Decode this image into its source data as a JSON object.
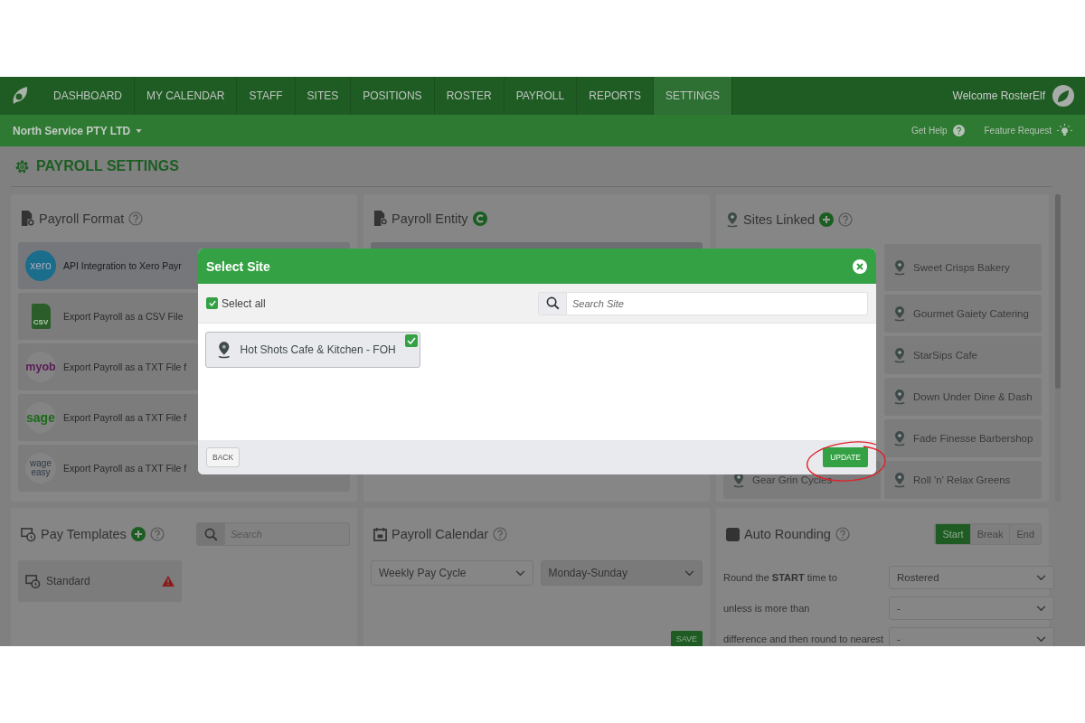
{
  "navbar": {
    "tabs": [
      {
        "label": "DASHBOARD",
        "selected": false
      },
      {
        "label": "MY CALENDAR",
        "selected": false
      },
      {
        "label": "STAFF",
        "selected": false
      },
      {
        "label": "SITES",
        "selected": false
      },
      {
        "label": "POSITIONS",
        "selected": false
      },
      {
        "label": "ROSTER",
        "selected": false
      },
      {
        "label": "PAYROLL",
        "selected": false
      },
      {
        "label": "REPORTS",
        "selected": false
      },
      {
        "label": "SETTINGS",
        "selected": true
      }
    ],
    "welcome": "Welcome RosterElf"
  },
  "subbar": {
    "company": "North Service PTY LTD",
    "links": [
      {
        "label": "Get Help",
        "kind": "help"
      },
      {
        "label": "Feature Request",
        "kind": "idea"
      }
    ]
  },
  "page_title": "PAYROLL SETTINGS",
  "payroll_format": {
    "title": "Payroll Format",
    "options": [
      {
        "kind": "xero",
        "logo": [
          "xero"
        ],
        "label": "API Integration to Xero Payr",
        "selected": true
      },
      {
        "kind": "csv",
        "logo": [
          "CSV"
        ],
        "label": "Export Payroll as a CSV File",
        "selected": false
      },
      {
        "kind": "myob",
        "logo": [
          "myob"
        ],
        "label": "Export Payroll as a TXT File f",
        "selected": false
      },
      {
        "kind": "sage",
        "logo": [
          "sage"
        ],
        "label": "Export Payroll as a TXT File f",
        "selected": false
      },
      {
        "kind": "wageeasy",
        "logo": [
          "wage",
          "easy"
        ],
        "label": "Export Payroll as a TXT File f",
        "selected": false
      }
    ]
  },
  "payroll_entity": {
    "title": "Payroll Entity"
  },
  "sites_linked": {
    "title": "Sites Linked",
    "left_sites": [
      "Gear Grin Cycles"
    ],
    "right_sites": [
      "Sweet Crisps Bakery",
      "Gourmet Gaiety Catering",
      "StarSips Cafe",
      "Down Under Dine & Dash",
      "Fade Finesse Barbershop",
      "Roll 'n' Relax Greens"
    ]
  },
  "pay_templates": {
    "title": "Pay Templates",
    "search_placeholder": "Search",
    "templates": [
      {
        "name": "Standard",
        "warning": true
      }
    ]
  },
  "payroll_calendar": {
    "title": "Payroll Calendar",
    "selects": [
      {
        "value": "Weekly Pay Cycle",
        "disabled": false
      },
      {
        "value": "Monday-Sunday",
        "disabled": true
      }
    ],
    "save": "SAVE"
  },
  "auto_rounding": {
    "title": "Auto Rounding",
    "checked": false,
    "segments": [
      {
        "label": "Start",
        "selected": true
      },
      {
        "label": "Break",
        "selected": false
      },
      {
        "label": "End",
        "selected": false
      }
    ],
    "rows": [
      {
        "label": "Round the **START** time to",
        "value": "Rostered"
      },
      {
        "label": "unless is more than",
        "value": "-"
      },
      {
        "label": "difference and then round to nearest",
        "value": "-"
      }
    ]
  },
  "modal": {
    "title": "Select Site",
    "select_all": {
      "label": "Select all",
      "checked": true
    },
    "search_placeholder": "Search Site",
    "sites": [
      {
        "name": "Hot Shots Cafe & Kitchen - FOH",
        "checked": true
      }
    ],
    "back": "BACK",
    "update": "UPDATE"
  }
}
